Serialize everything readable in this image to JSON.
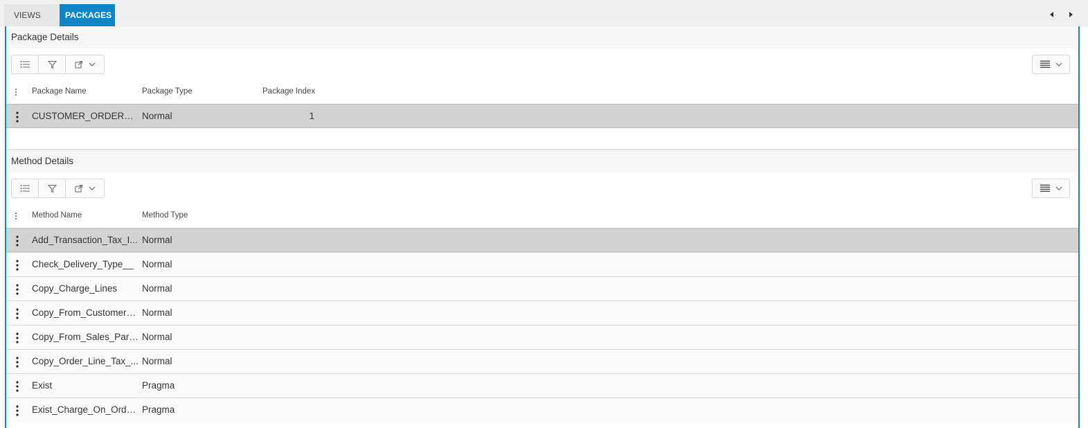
{
  "tabs": {
    "views": "VIEWS",
    "packages": "PACKAGES"
  },
  "package_section": {
    "title": "Package Details",
    "columns": {
      "name": "Package Name",
      "type": "Package Type",
      "index": "Package Index"
    },
    "rows": [
      {
        "name": "CUSTOMER_ORDER_C...",
        "type": "Normal",
        "index": "1"
      }
    ]
  },
  "method_section": {
    "title": "Method Details",
    "columns": {
      "name": "Method Name",
      "type": "Method Type"
    },
    "rows": [
      {
        "name": "Add_Transaction_Tax_I...",
        "type": "Normal"
      },
      {
        "name": "Check_Delivery_Type__",
        "type": "Normal"
      },
      {
        "name": "Copy_Charge_Lines",
        "type": "Normal"
      },
      {
        "name": "Copy_From_Customer_...",
        "type": "Normal"
      },
      {
        "name": "Copy_From_Sales_Part...",
        "type": "Normal"
      },
      {
        "name": "Copy_Order_Line_Tax_...",
        "type": "Normal"
      },
      {
        "name": "Exist",
        "type": "Pragma"
      },
      {
        "name": "Exist_Charge_On_Orde...",
        "type": "Pragma"
      }
    ]
  },
  "icons": {
    "list": "list-icon",
    "filter": "filter-icon",
    "export": "export-icon",
    "chevron": "chevron-down-icon",
    "layout": "table-layout-icon",
    "kebab": "kebab-menu-icon",
    "prev": "chevron-left-icon",
    "next": "chevron-right-icon"
  },
  "colors": {
    "accent": "#0e85c6",
    "selected_row": "#d3d3d3"
  }
}
